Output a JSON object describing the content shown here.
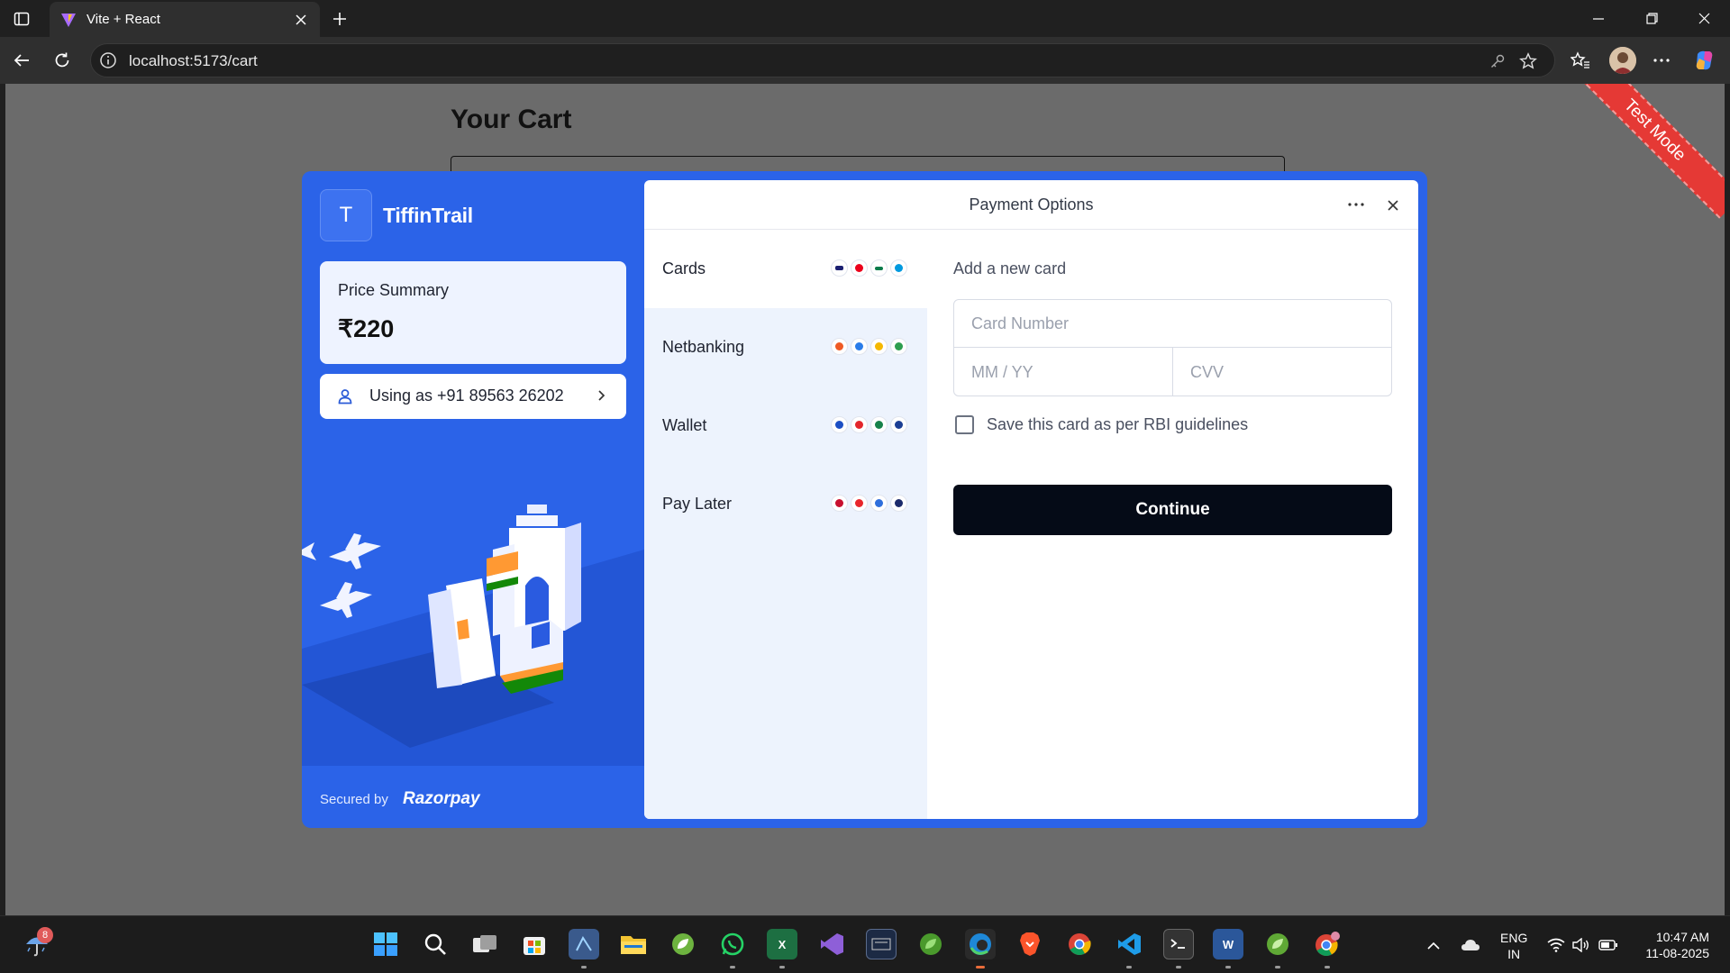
{
  "browser": {
    "tab_title": "Vite + React",
    "url": "localhost:5173/cart"
  },
  "page": {
    "heading": "Your Cart",
    "ribbon": "Test Mode"
  },
  "checkout": {
    "brand_initial": "T",
    "brand_name": "TiffinTrail",
    "price_summary_label": "Price Summary",
    "price_value": "₹220",
    "user_label": "Using as +91 89563 26202",
    "secured_by": "Secured by",
    "provider": "Razorpay",
    "header_title": "Payment Options",
    "methods": [
      {
        "label": "Cards",
        "icons": [
          "visa-icon",
          "mastercard-icon",
          "rupay-icon",
          "maestro-icon"
        ]
      },
      {
        "label": "Netbanking",
        "icons": [
          "bank-icon",
          "bank-icon",
          "bank-icon",
          "bank-icon"
        ]
      },
      {
        "label": "Wallet",
        "icons": [
          "wallet-icon",
          "wallet-icon",
          "wallet-icon",
          "wallet-icon"
        ]
      },
      {
        "label": "Pay Later",
        "icons": [
          "paylater-icon",
          "paylater-icon",
          "paylater-icon",
          "paylater-icon"
        ]
      }
    ],
    "card_form": {
      "title": "Add a new card",
      "card_number_placeholder": "Card Number",
      "expiry_placeholder": "MM / YY",
      "cvv_placeholder": "CVV",
      "save_label": "Save this card as per RBI guidelines",
      "save_checked": false,
      "continue_label": "Continue"
    }
  },
  "taskbar": {
    "weather_badge": "8",
    "lang_line1": "ENG",
    "lang_line2": "IN",
    "time": "10:47 AM",
    "date": "11-08-2025"
  },
  "colors": {
    "brand_blue": "#2b63e8",
    "methods_bg": "#edf3fd",
    "continue_bg": "#050b17",
    "ribbon_red": "#e53935"
  }
}
